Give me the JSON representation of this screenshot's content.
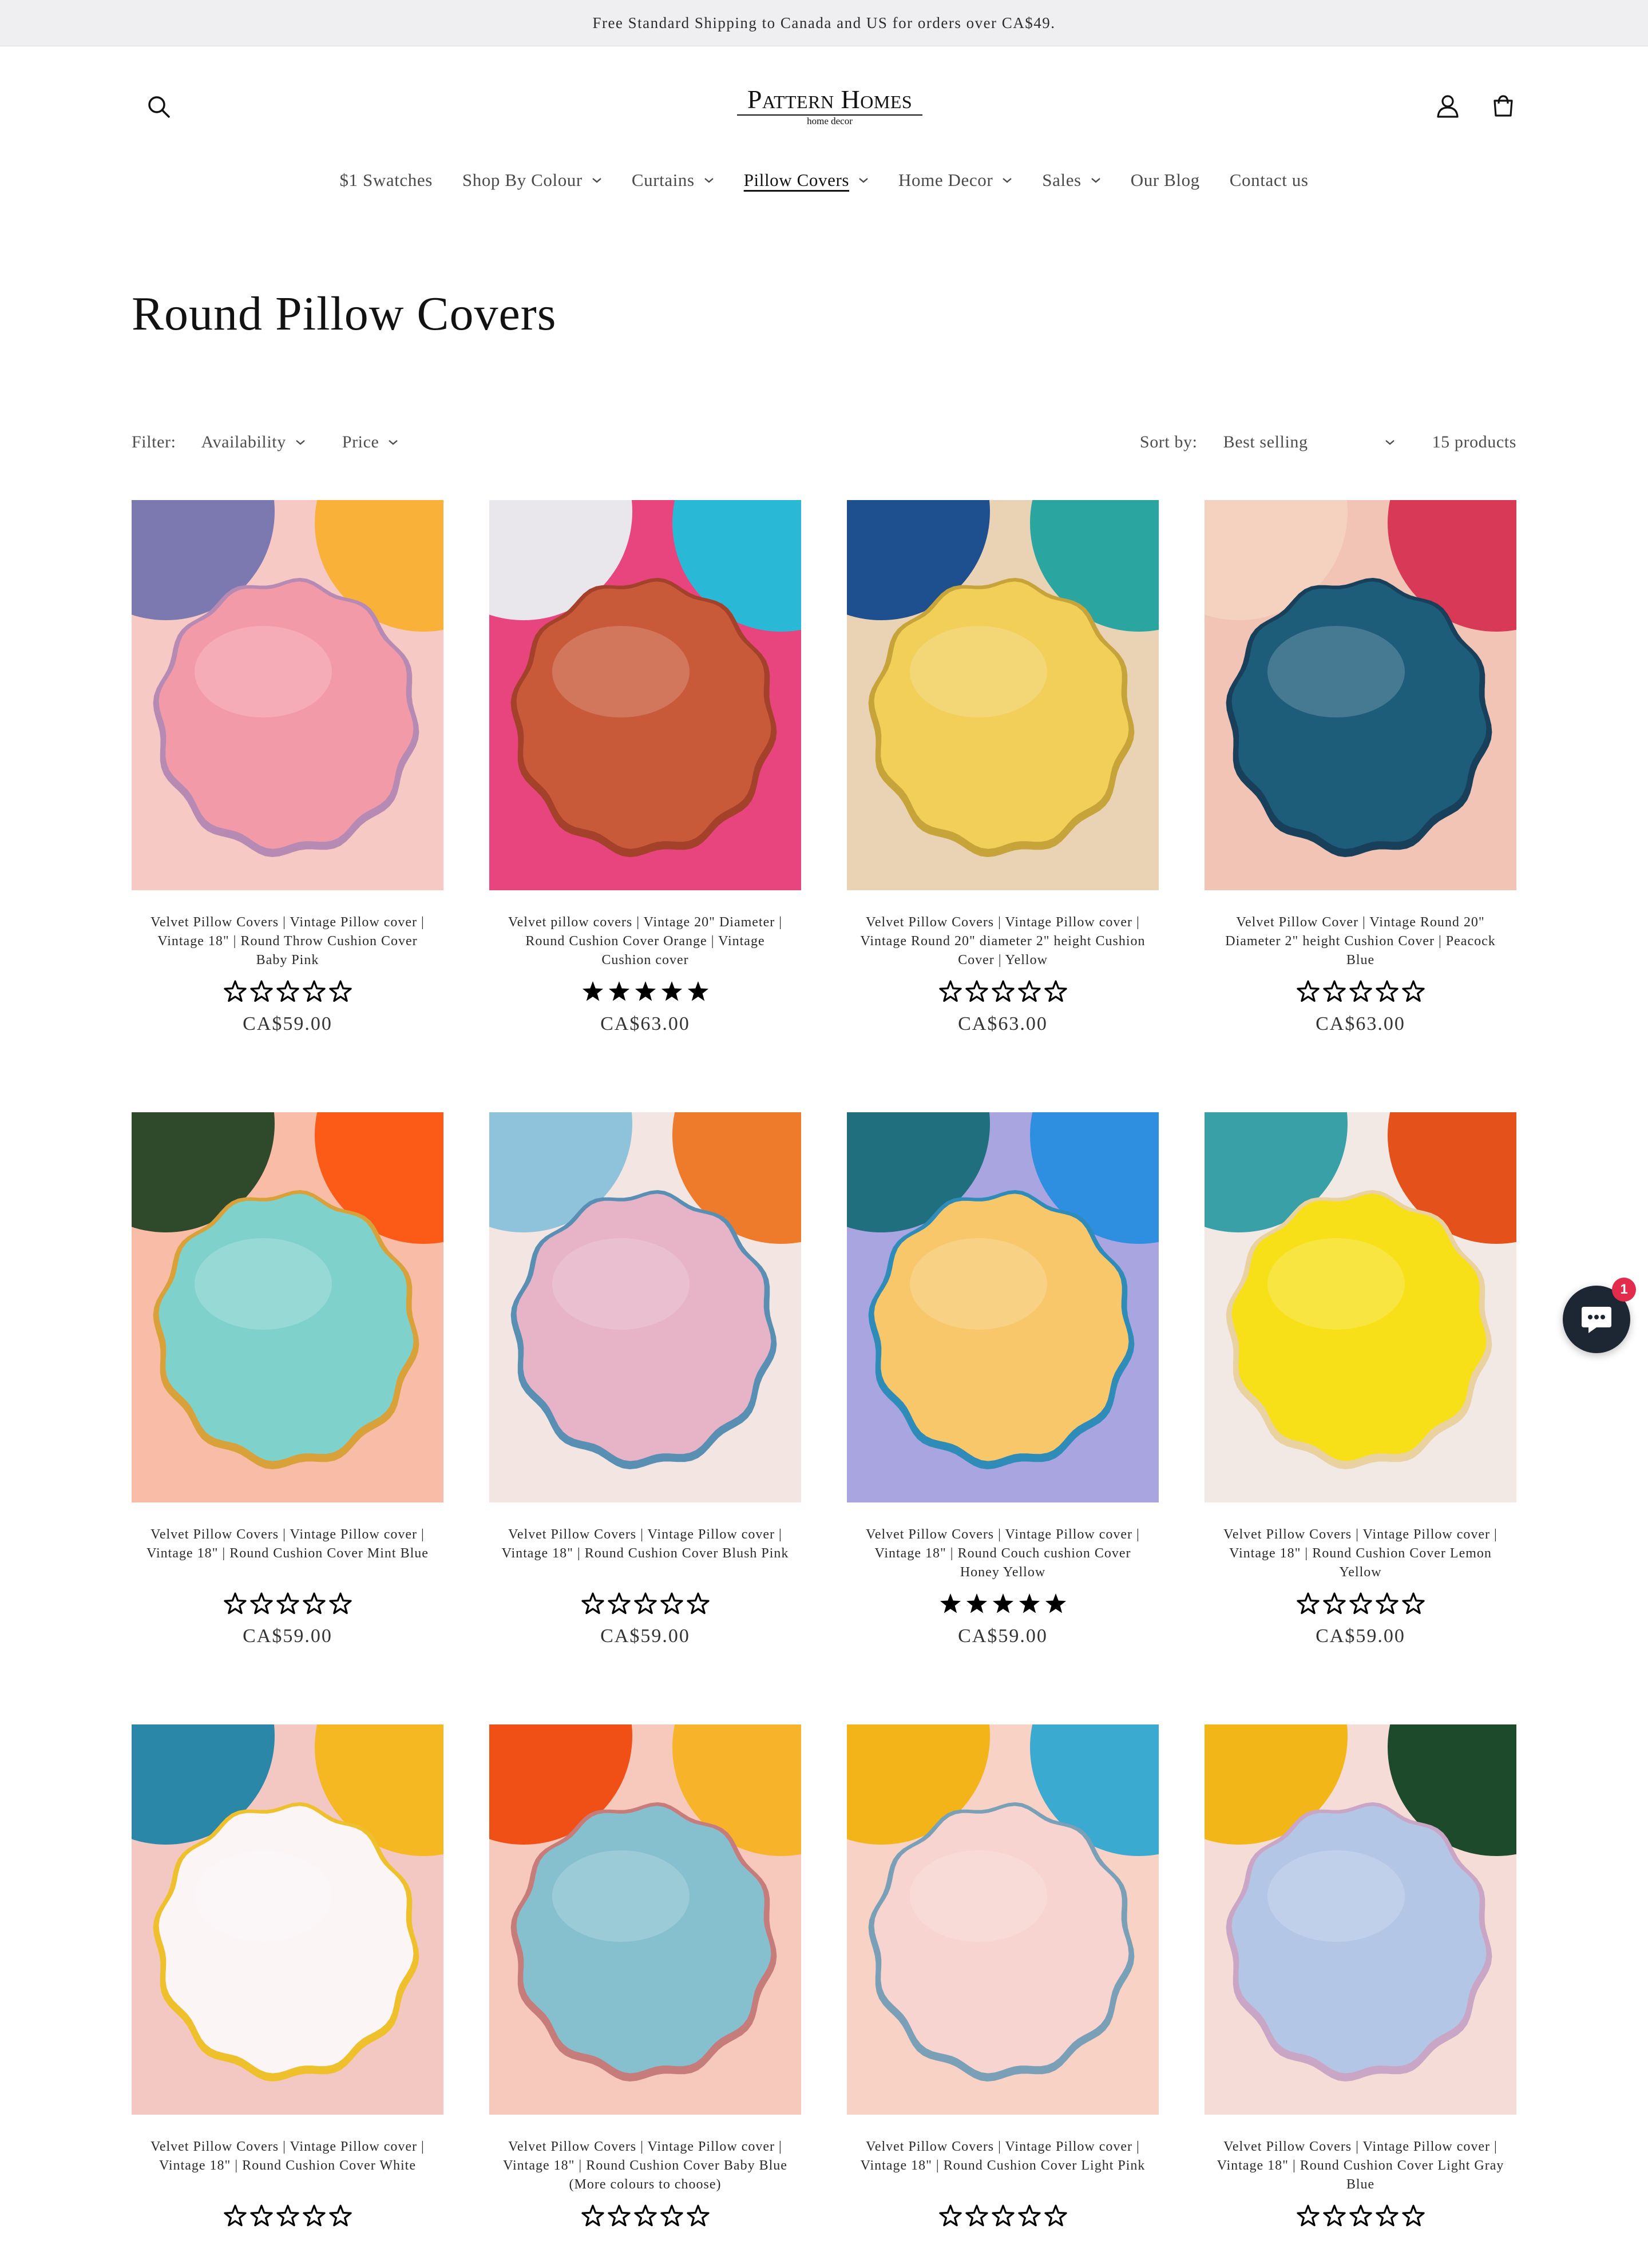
{
  "announcement": "Free Standard Shipping to Canada and US for orders over CA$49.",
  "header": {
    "logo_main": "Pattern Homes",
    "logo_sub": "home decor",
    "icons": [
      "search-icon",
      "account-icon",
      "cart-icon"
    ]
  },
  "nav": [
    {
      "label": "$1 Swatches",
      "dropdown": false,
      "active": false
    },
    {
      "label": "Shop By Colour",
      "dropdown": true,
      "active": false
    },
    {
      "label": "Curtains",
      "dropdown": true,
      "active": false
    },
    {
      "label": "Pillow Covers",
      "dropdown": true,
      "active": true
    },
    {
      "label": "Home Decor",
      "dropdown": true,
      "active": false
    },
    {
      "label": "Sales",
      "dropdown": true,
      "active": false
    },
    {
      "label": "Our Blog",
      "dropdown": false,
      "active": false
    },
    {
      "label": "Contact us",
      "dropdown": false,
      "active": false
    }
  ],
  "collection": {
    "title": "Round Pillow Covers",
    "filter_label": "Filter:",
    "filters": [
      "Availability",
      "Price"
    ],
    "sort_label": "Sort by:",
    "sort_value": "Best selling",
    "product_count": "15 products"
  },
  "products": [
    {
      "title": "Velvet Pillow Covers | Vintage Pillow cover | Vintage 18\" | Round Throw Cushion Cover Baby Pink",
      "price": "CA$59.00",
      "rating": 0,
      "colors": {
        "bg": "#f6c9c4",
        "pillow": "#f39aa8",
        "edge": "#b78ab4",
        "accent1": "#7c78b0",
        "accent2": "#f9b13a"
      }
    },
    {
      "title": "Velvet pillow covers | Vintage 20\" Diameter | Round Cushion Cover Orange | Vintage Cushion cover",
      "price": "CA$63.00",
      "rating": 5,
      "colors": {
        "bg": "#e8447e",
        "pillow": "#c95a39",
        "edge": "#a4412a",
        "accent1": "#e9e7ec",
        "accent2": "#29b8d6"
      }
    },
    {
      "title": "Velvet Pillow Covers | Vintage Pillow cover | Vintage Round 20\" diameter 2\" height Cushion Cover | Yellow",
      "price": "CA$63.00",
      "rating": 0,
      "colors": {
        "bg": "#e9d3b4",
        "pillow": "#f1cf58",
        "edge": "#c7a43a",
        "accent1": "#1e4f8f",
        "accent2": "#2aa5a0"
      }
    },
    {
      "title": "Velvet Pillow Cover | Vintage Round 20\" Diameter 2\" height Cushion Cover | Peacock Blue",
      "price": "CA$63.00",
      "rating": 0,
      "colors": {
        "bg": "#f2c4b6",
        "pillow": "#1e5d7a",
        "edge": "#18405a",
        "accent1": "#f4d2bf",
        "accent2": "#d83956"
      }
    },
    {
      "title": "Velvet Pillow Covers | Vintage Pillow cover | Vintage 18\" | Round Cushion Cover Mint Blue",
      "price": "CA$59.00",
      "rating": 0,
      "colors": {
        "bg": "#f9bca6",
        "pillow": "#7fd1cc",
        "edge": "#d8a13a",
        "accent1": "#2f4a2a",
        "accent2": "#fb5a17"
      }
    },
    {
      "title": "Velvet Pillow Covers | Vintage Pillow cover | Vintage 18\" | Round Cushion Cover Blush Pink",
      "price": "CA$59.00",
      "rating": 0,
      "colors": {
        "bg": "#f3e6e2",
        "pillow": "#e6b3c7",
        "edge": "#5a8fb4",
        "accent1": "#8ec3db",
        "accent2": "#ee7a2c"
      }
    },
    {
      "title": "Velvet Pillow Covers | Vintage Pillow cover | Vintage 18\" | Round Couch cushion Cover Honey Yellow",
      "price": "CA$59.00",
      "rating": 5,
      "colors": {
        "bg": "#a8a5e0",
        "pillow": "#f7c76a",
        "edge": "#2f8cb9",
        "accent1": "#1f6f7f",
        "accent2": "#2e8fe0"
      }
    },
    {
      "title": "Velvet Pillow Covers | Vintage Pillow cover | Vintage 18\" | Round Cushion Cover Lemon Yellow",
      "price": "CA$59.00",
      "rating": 0,
      "colors": {
        "bg": "#f2e9e4",
        "pillow": "#f7e018",
        "edge": "#e9d2a0",
        "accent1": "#3aa0a8",
        "accent2": "#e4511a"
      }
    },
    {
      "title": "Velvet Pillow Covers | Vintage Pillow cover | Vintage 18\" | Round Cushion Cover White",
      "price": "",
      "rating": 0,
      "colors": {
        "bg": "#f3c7c2",
        "pillow": "#fbf5f6",
        "edge": "#eec02b",
        "accent1": "#2a87a8",
        "accent2": "#f5b822"
      }
    },
    {
      "title": "Velvet Pillow Covers | Vintage Pillow cover | Vintage 18\" | Round Cushion Cover Baby Blue (More colours to choose)",
      "price": "",
      "rating": 0,
      "colors": {
        "bg": "#f6c9bc",
        "pillow": "#86c0cf",
        "edge": "#c57c7a",
        "accent1": "#f04f16",
        "accent2": "#f7b42b"
      }
    },
    {
      "title": "Velvet Pillow Covers | Vintage Pillow cover | Vintage 18\" | Round Cushion Cover Light Pink",
      "price": "",
      "rating": 0,
      "colors": {
        "bg": "#f8d2c4",
        "pillow": "#f7d4cf",
        "edge": "#7aa0b8",
        "accent1": "#f2b419",
        "accent2": "#3aaad0"
      }
    },
    {
      "title": "Velvet Pillow Covers | Vintage Pillow cover | Vintage 18\" | Round Cushion Cover Light Gray Blue",
      "price": "",
      "rating": 0,
      "colors": {
        "bg": "#f6dcd6",
        "pillow": "#b4c6e6",
        "edge": "#c9a6c6",
        "accent1": "#f2b619",
        "accent2": "#1e4a2c"
      }
    }
  ],
  "chat": {
    "badge_count": "1",
    "icon": "chat-icon"
  }
}
